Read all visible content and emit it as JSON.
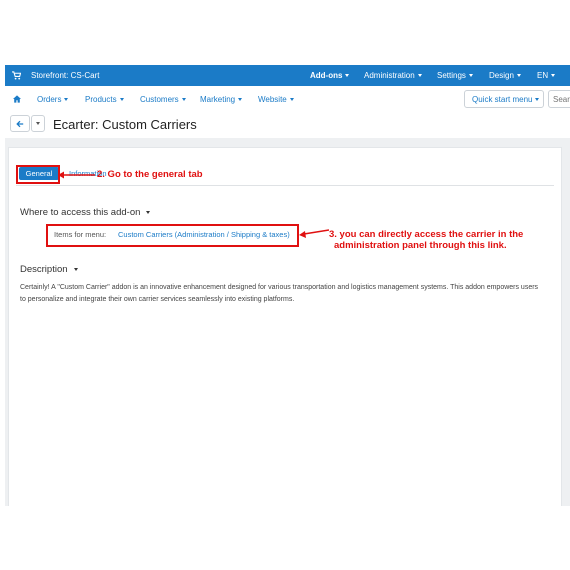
{
  "topbar": {
    "store_label": "Storefront: CS-Cart",
    "nav": [
      "Add-ons",
      "Administration",
      "Settings",
      "Design",
      "EN"
    ],
    "active": "Add-ons",
    "color": "#1b7bc7"
  },
  "navbar": {
    "items": [
      "Orders",
      "Products",
      "Customers",
      "Marketing",
      "Website"
    ],
    "quick_start": "Quick start menu",
    "search_placeholder": "Search"
  },
  "page": {
    "title": "Ecarter: Custom Carriers"
  },
  "tabs": {
    "general": "General",
    "information": "Information"
  },
  "sections": {
    "access_title": "Where to access this add-on",
    "items_for_menu_label": "Items for menu:",
    "items_for_menu_link": "Custom Carriers (Administration / Shipping & taxes)",
    "description_title": "Description",
    "description_text": "Certainly! A \"Custom Carrier\" addon is an innovative enhancement designed for various transportation and logistics management systems. This addon empowers users to personalize and integrate their own carrier services seamlessly into existing platforms."
  },
  "annotations": {
    "step2": "2. Go to the general tab",
    "step3_line1": "3. you can directly access the carrier in the",
    "step3_line2": "administration panel through this link.",
    "color": "#e01010"
  }
}
